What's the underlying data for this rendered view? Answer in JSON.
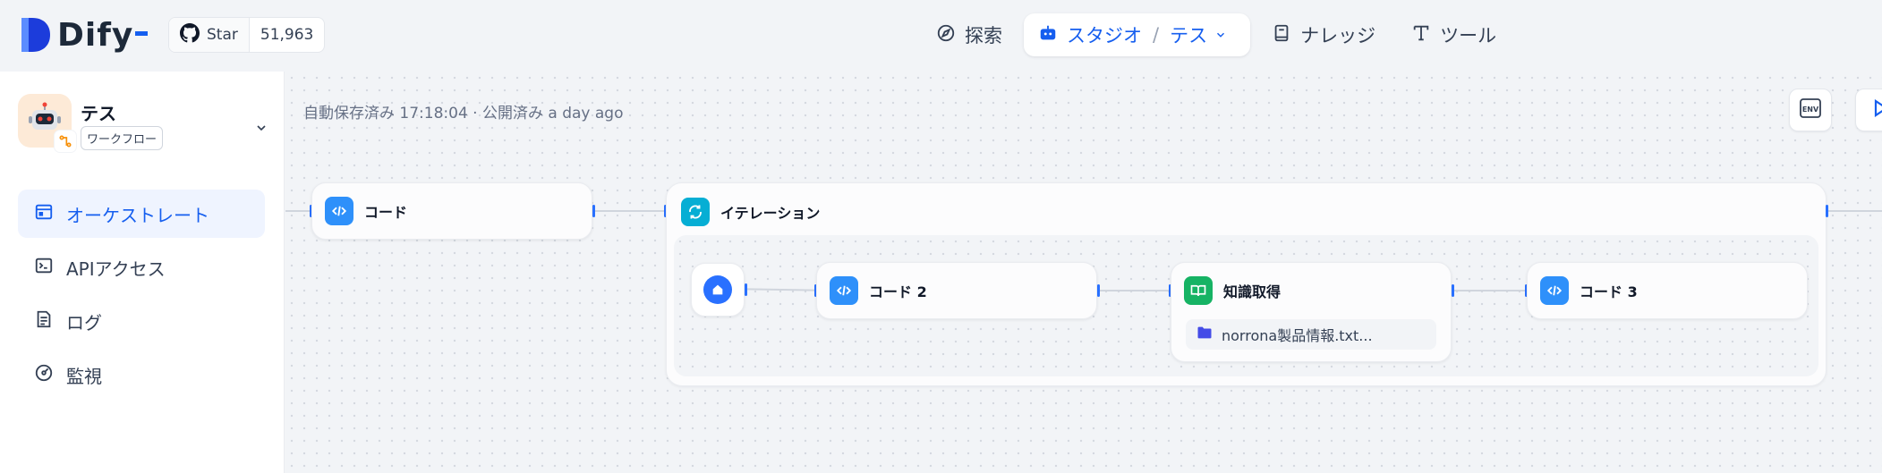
{
  "header": {
    "logo_text": "Dify",
    "github": {
      "star_label": "Star",
      "star_count": "51,963"
    },
    "nav": {
      "explore": "探索",
      "studio": "スタジオ",
      "studio_separator": "/",
      "current_app": "テス",
      "knowledge": "ナレッジ",
      "tools": "ツール"
    }
  },
  "sidebar": {
    "app_name": "テス",
    "app_type": "ワークフロー",
    "menu": [
      {
        "label": "オーケストレート",
        "active": true
      },
      {
        "label": "APIアクセス",
        "active": false
      },
      {
        "label": "ログ",
        "active": false
      },
      {
        "label": "監視",
        "active": false
      }
    ]
  },
  "canvas": {
    "autosave_text": "自動保存済み 17:18:04 · 公開済み a day ago",
    "env_label": "ENV",
    "nodes": {
      "code": "コード",
      "iteration": "イテレーション",
      "code2": "コード 2",
      "knowledge_retrieval": "知識取得",
      "knowledge_file": "norrona製品情報.txt...",
      "code3": "コード 3"
    }
  },
  "colors": {
    "accent": "#155eef",
    "code_node": "#2e90fa",
    "iteration_node": "#06aed4",
    "knowledge_node": "#16b364"
  }
}
